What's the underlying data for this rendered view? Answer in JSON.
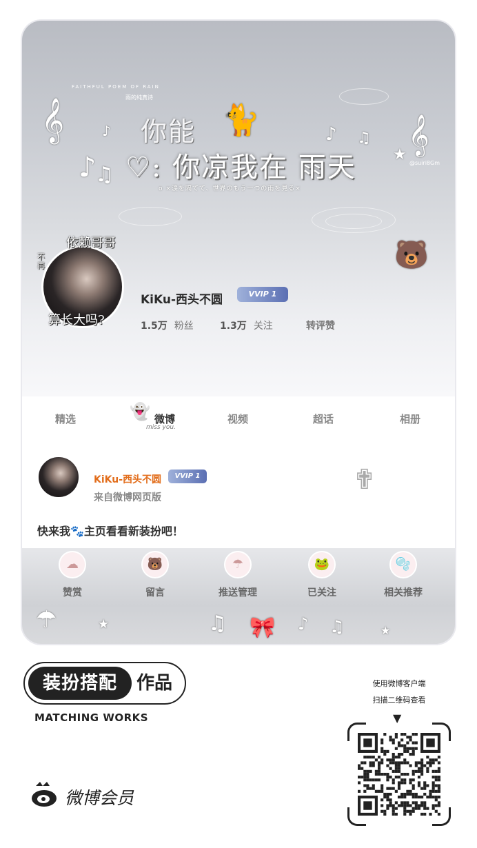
{
  "banner": {
    "title_top": "你能",
    "title_main": "♡: 你凉我在 雨天",
    "subtitle": "o ×涙を隔てて、世界のもう一つの雨を見る×",
    "small_text": "FAITHFUL POEM OF RAIN",
    "small_text2": "雨的纯真诗",
    "handle": "@suiri8Gm"
  },
  "profile": {
    "avatar_text_top": "依赖哥哥",
    "avatar_text_side": "不再",
    "avatar_text_bottom": "算长大吗?",
    "username": "KiKu-西头不圆",
    "vip_badge": "VVIP 1",
    "fans_count": "1.5万",
    "fans_label": "粉丝",
    "follow_count": "1.3万",
    "follow_label": "关注",
    "likes_label": "转评赞"
  },
  "tabs": [
    {
      "label": "精选"
    },
    {
      "label": "微博"
    },
    {
      "label": "视频"
    },
    {
      "label": "超话"
    },
    {
      "label": "相册"
    }
  ],
  "tab_caption": "miss you.",
  "post": {
    "author": "KiKu-西头不圆",
    "vip_badge": "VVIP 1",
    "source": "来自微博网页版",
    "text": "快来我🐾主页看看新装扮吧！"
  },
  "actions": [
    {
      "label": "赞赏",
      "icon": "cloud-icon"
    },
    {
      "label": "留言",
      "icon": "pink-bear-icon"
    },
    {
      "label": "推送管理",
      "icon": "umbrella-bear-icon"
    },
    {
      "label": "已关注",
      "icon": "bear-frog-icon"
    },
    {
      "label": "相关推荐",
      "icon": "bubble-bear-icon"
    }
  ],
  "brand": {
    "dark_label": "装扮搭配",
    "light_label": "作品",
    "english": "MATCHING WORKS",
    "weibo_member": "微博会员"
  },
  "qr": {
    "line1": "使用微博客户端",
    "line2": "扫描二维码查看",
    "arrow": "▼"
  },
  "colors": {
    "accent_orange": "#e26d1b",
    "vip_blue": "#5b6fb3",
    "banner_gray": "#c9ccd2"
  }
}
